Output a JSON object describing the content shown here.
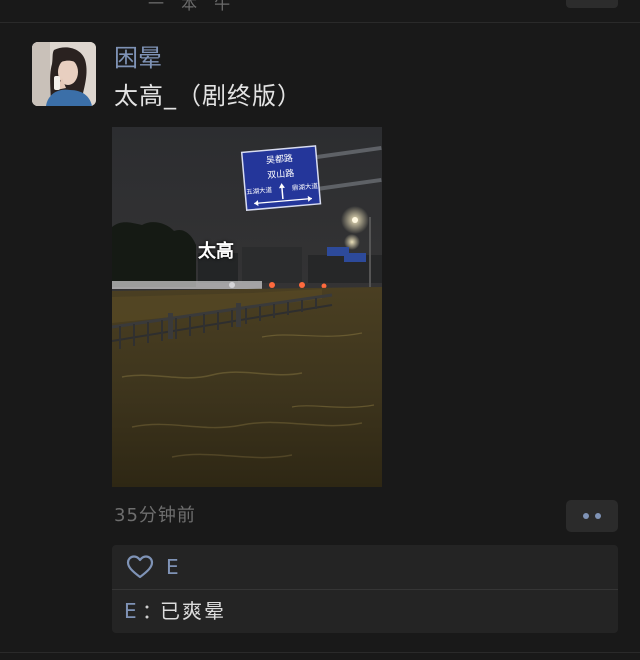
{
  "previous_post": {
    "partial_text": "一 本 牛"
  },
  "post": {
    "author": "困晕",
    "content": "太高_（剧终版）",
    "image_caption": "太高",
    "sign": {
      "line1": "吴都路",
      "line2": "双山路",
      "left_label": "五湖大道",
      "right_label": "鼎湖大道"
    },
    "time": "35分钟前"
  },
  "likes": {
    "names": "E"
  },
  "comments": [
    {
      "author": "E",
      "separator": "：",
      "text": "已爽晕"
    }
  ],
  "colors": {
    "background": "#191919",
    "name_link": "#7f93b6",
    "text_primary": "#e3e3e3",
    "text_muted": "#6e6e6e",
    "panel": "#242424"
  },
  "icons": {
    "like": "heart-outline-icon",
    "more": "more-dots-icon"
  }
}
